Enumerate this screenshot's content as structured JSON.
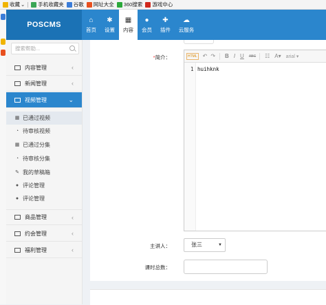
{
  "browser": {
    "bookmarks": [
      {
        "label": "收藏",
        "icon": "star-icon",
        "color": "#f0b400"
      },
      {
        "label": "手机收藏夹",
        "icon": "phone-icon",
        "color": "#3aa655"
      },
      {
        "label": "谷歌",
        "icon": "page-icon",
        "color": "#3b7dd8"
      },
      {
        "label": "网址大全",
        "icon": "page-icon",
        "color": "#e8501f"
      },
      {
        "label": "360搜索",
        "icon": "search-360-icon",
        "color": "#2ca83a"
      },
      {
        "label": "游戏中心",
        "icon": "game-icon",
        "color": "#d0291d"
      }
    ]
  },
  "app": {
    "logo": "POSCMS",
    "accent": "#2b86cd",
    "logo_bg": "#1b72b5"
  },
  "topnav": {
    "items": [
      {
        "label": "首页",
        "icon": "home-icon",
        "glyph": "⌂",
        "active": false
      },
      {
        "label": "设置",
        "icon": "gear-icon",
        "glyph": "✱",
        "active": false
      },
      {
        "label": "内容",
        "icon": "grid-icon",
        "glyph": "▦",
        "active": true
      },
      {
        "label": "会员",
        "icon": "user-icon",
        "glyph": "●",
        "active": false
      },
      {
        "label": "插件",
        "icon": "puzzle-icon",
        "glyph": "✚",
        "active": false
      },
      {
        "label": "云服务",
        "icon": "cloud-icon",
        "glyph": "☁",
        "active": false
      }
    ]
  },
  "sidebar": {
    "search_placeholder": "搜索帮助...",
    "menus": [
      {
        "label": "内容管理",
        "icon": "grid-icon",
        "open": false
      },
      {
        "label": "新闻管理",
        "icon": "list-icon",
        "open": false
      },
      {
        "label": "视频管理",
        "icon": "video-icon",
        "open": true
      },
      {
        "label": "商品管理",
        "icon": "table-icon",
        "open": false
      },
      {
        "label": "约会管理",
        "icon": "table-icon",
        "open": false
      },
      {
        "label": "福利管理",
        "icon": "table-icon",
        "open": false
      }
    ],
    "submenu": [
      {
        "label": "已通过视频",
        "icon": "grid-icon",
        "glyph": "▦",
        "active": true
      },
      {
        "label": "待审核视频",
        "icon": "clock-icon",
        "glyph": "◔",
        "active": false
      },
      {
        "label": "已通过分集",
        "icon": "grid-icon",
        "glyph": "▦",
        "active": false
      },
      {
        "label": "待审核分集",
        "icon": "clock-icon",
        "glyph": "◔",
        "active": false
      },
      {
        "label": "我的草稿箱",
        "icon": "edit-icon",
        "glyph": "✎",
        "active": false
      },
      {
        "label": "评论管理",
        "icon": "comment-icon",
        "glyph": "●",
        "active": false
      },
      {
        "label": "评论管理",
        "icon": "comment-icon",
        "glyph": "●",
        "active": false
      }
    ]
  },
  "form": {
    "intro_label": "简介：",
    "required_mark": "*",
    "editor": {
      "line_number": "1",
      "content": "huihknk",
      "font_name": "arial",
      "toolbar": [
        "HTML",
        "↶",
        "↷",
        "B",
        "I",
        "U",
        "ABC",
        "☷",
        "A▾",
        "arial ▾"
      ]
    },
    "speaker_label": "主讲人：",
    "speaker_value": "张三",
    "lessons_label": "课时总数：",
    "lessons_value": ""
  }
}
